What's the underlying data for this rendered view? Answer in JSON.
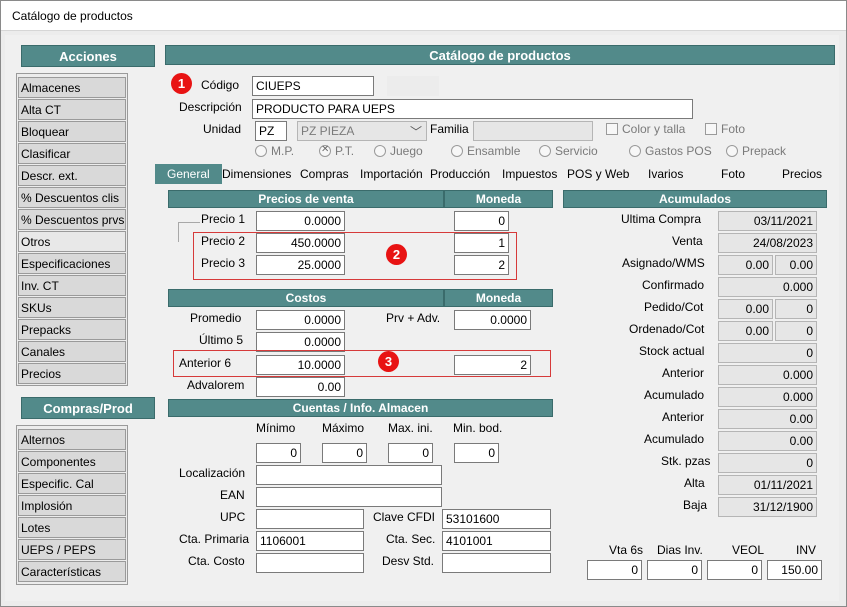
{
  "window": {
    "title": "Catálogo de productos"
  },
  "sidebar": {
    "acciones_header": "Acciones",
    "acciones": [
      "Almacenes",
      "Alta CT",
      "Bloquear",
      "Clasificar",
      "Descr. ext.",
      "% Descuentos clis",
      "% Descuentos prvs",
      "Otros",
      "Especificaciones",
      "Inv. CT",
      "SKUs",
      "Prepacks",
      "Canales",
      "Precios"
    ],
    "compras_header": "Compras/Prod",
    "compras": [
      "Alternos",
      "Componentes",
      "Especific. Cal",
      "Implosión",
      "Lotes",
      "UEPS / PEPS",
      "Características"
    ]
  },
  "main_header": "Catálogo de productos",
  "product": {
    "codigo_label": "Código",
    "codigo": "CIUEPS",
    "descripcion_label": "Descripción",
    "descripcion": "PRODUCTO PARA UEPS",
    "unidad_label": "Unidad",
    "unidad": "PZ",
    "unidad_desc": "PZ  PIEZA",
    "familia_label": "Familia",
    "familia": "",
    "color_talla": "Color y talla",
    "foto": "Foto",
    "types": [
      "M.P.",
      "P.T.",
      "Juego",
      "Ensamble",
      "Servicio",
      "Gastos POS",
      "Prepack"
    ]
  },
  "tabs": [
    "General",
    "Dimensiones",
    "Compras",
    "Importación",
    "Producción",
    "Impuestos",
    "POS y Web",
    "Ivarios",
    "Foto",
    "Precios"
  ],
  "precios": {
    "header": "Precios de venta",
    "moneda_header": "Moneda",
    "rows": [
      {
        "label": "Precio 1",
        "value": "0.0000",
        "moneda": "0"
      },
      {
        "label": "Precio 2",
        "value": "450.0000",
        "moneda": "1"
      },
      {
        "label": "Precio 3",
        "value": "25.0000",
        "moneda": "2"
      }
    ]
  },
  "costos": {
    "header": "Costos",
    "moneda_header": "Moneda",
    "promedio_label": "Promedio",
    "promedio": "0.0000",
    "prv_label": "Prv + Adv.",
    "prv": "0.0000",
    "ultimo_label": "Último 5",
    "ultimo": "0.0000",
    "anterior_label": "Anterior 6",
    "anterior": "10.0000",
    "anterior_moneda": "2",
    "advalorem_label": "Advalorem",
    "advalorem": "0.00"
  },
  "cuentas": {
    "header": "Cuentas / Info. Almacen",
    "minimo_label": "Mínimo",
    "minimo": "0",
    "maximo_label": "Máximo",
    "maximo": "0",
    "maxini_label": "Max. ini.",
    "maxini": "0",
    "minbod_label": "Min. bod.",
    "minbod": "0",
    "localizacion_label": "Localización",
    "localizacion": "",
    "ean_label": "EAN",
    "ean": "",
    "upc_label": "UPC",
    "upc": "",
    "clave_cfdi_label": "Clave CFDI",
    "clave_cfdi": "53101600",
    "cta_primaria_label": "Cta. Primaria",
    "cta_primaria": "1106001",
    "cta_sec_label": "Cta. Sec.",
    "cta_sec": "4101001",
    "cta_costo_label": "Cta. Costo",
    "cta_costo": "",
    "desv_label": "Desv Std.",
    "desv": ""
  },
  "acumulados": {
    "header": "Acumulados",
    "ultima_compra_label": "Ultima  Compra",
    "ultima_compra": "03/11/2021",
    "venta_label": "Venta",
    "venta": "24/08/2023",
    "asignado_label": "Asignado/WMS",
    "asignado_a": "0.00",
    "asignado_b": "0.00",
    "confirmado_label": "Confirmado",
    "confirmado": "0.000",
    "pedido_label": "Pedido/Cot",
    "pedido_a": "0.00",
    "pedido_b": "0",
    "ordenado_label": "Ordenado/Cot",
    "ordenado_a": "0.00",
    "ordenado_b": "0",
    "stock_label": "Stock actual",
    "stock": "0",
    "anterior1_label": "Anterior",
    "anterior1": "0.000",
    "acumulado1_label": "Acumulado",
    "acumulado1": "0.000",
    "anterior2_label": "Anterior",
    "anterior2": "0.00",
    "acumulado2_label": "Acumulado",
    "acumulado2": "0.00",
    "stk_label": "Stk. pzas",
    "stk": "0",
    "alta_label": "Alta",
    "alta": "01/11/2021",
    "baja_label": "Baja",
    "baja": "31/12/1900",
    "vta6s_label": "Vta 6s",
    "vta6s": "0",
    "diasinv_label": "Dias Inv.",
    "diasinv": "0",
    "veol_label": "VEOL",
    "veol": "0",
    "inv_label": "INV",
    "inv": "150.00"
  },
  "badges": [
    "1",
    "2",
    "3"
  ]
}
